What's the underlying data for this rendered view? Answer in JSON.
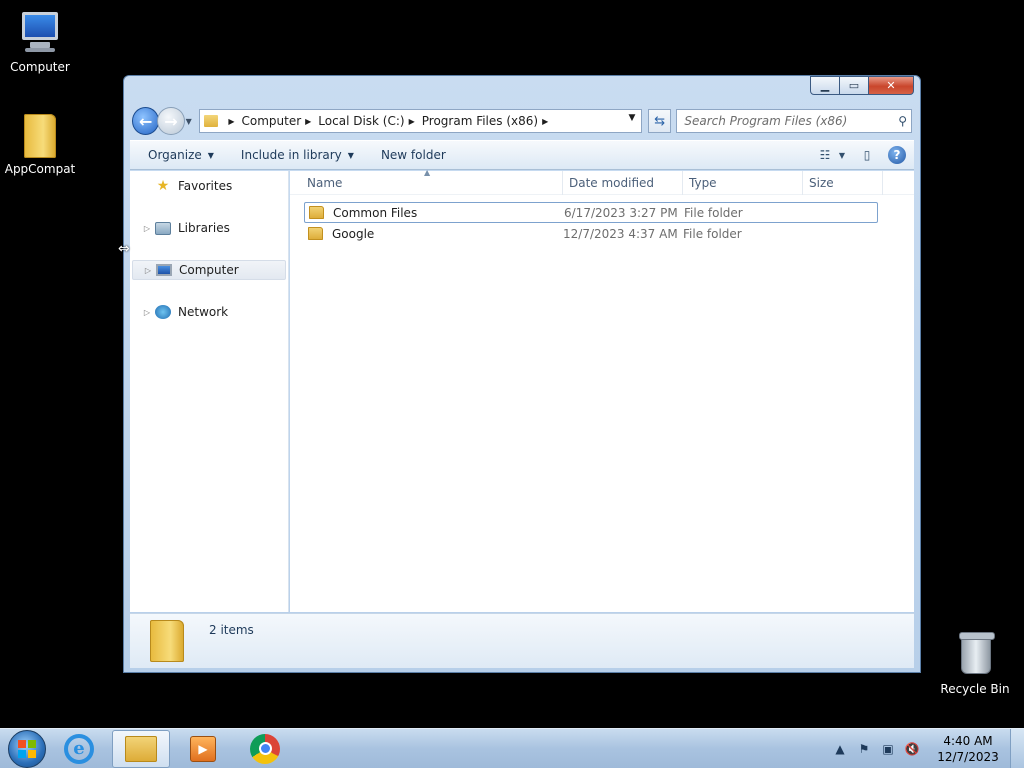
{
  "desktop": {
    "icons": [
      {
        "label": "Computer"
      },
      {
        "label": "AppCompat"
      },
      {
        "label": "Recycle Bin"
      }
    ]
  },
  "window": {
    "breadcrumb": [
      "Computer",
      "Local Disk (C:)",
      "Program Files (x86)"
    ],
    "search_placeholder": "Search Program Files (x86)",
    "toolbar": {
      "organize": "Organize",
      "include_in_library": "Include in library",
      "new_folder": "New folder"
    },
    "navpane": {
      "items": [
        {
          "label": "Favorites",
          "icon": "star-icon"
        },
        {
          "label": "Libraries",
          "icon": "libraries-icon"
        },
        {
          "label": "Computer",
          "icon": "computer-icon"
        },
        {
          "label": "Network",
          "icon": "network-icon"
        }
      ]
    },
    "columns": {
      "name": "Name",
      "date": "Date modified",
      "type": "Type",
      "size": "Size"
    },
    "files": [
      {
        "name": "Common Files",
        "date": "6/17/2023 3:27 PM",
        "type": "File folder",
        "size": ""
      },
      {
        "name": "Google",
        "date": "12/7/2023 4:37 AM",
        "type": "File folder",
        "size": ""
      }
    ],
    "status": {
      "item_count": "2 items"
    }
  },
  "taskbar": {
    "apps": [
      "internet-explorer-icon",
      "windows-explorer-icon",
      "media-player-icon",
      "chrome-icon"
    ],
    "clock": {
      "time": "4:40 AM",
      "date": "12/7/2023"
    }
  }
}
